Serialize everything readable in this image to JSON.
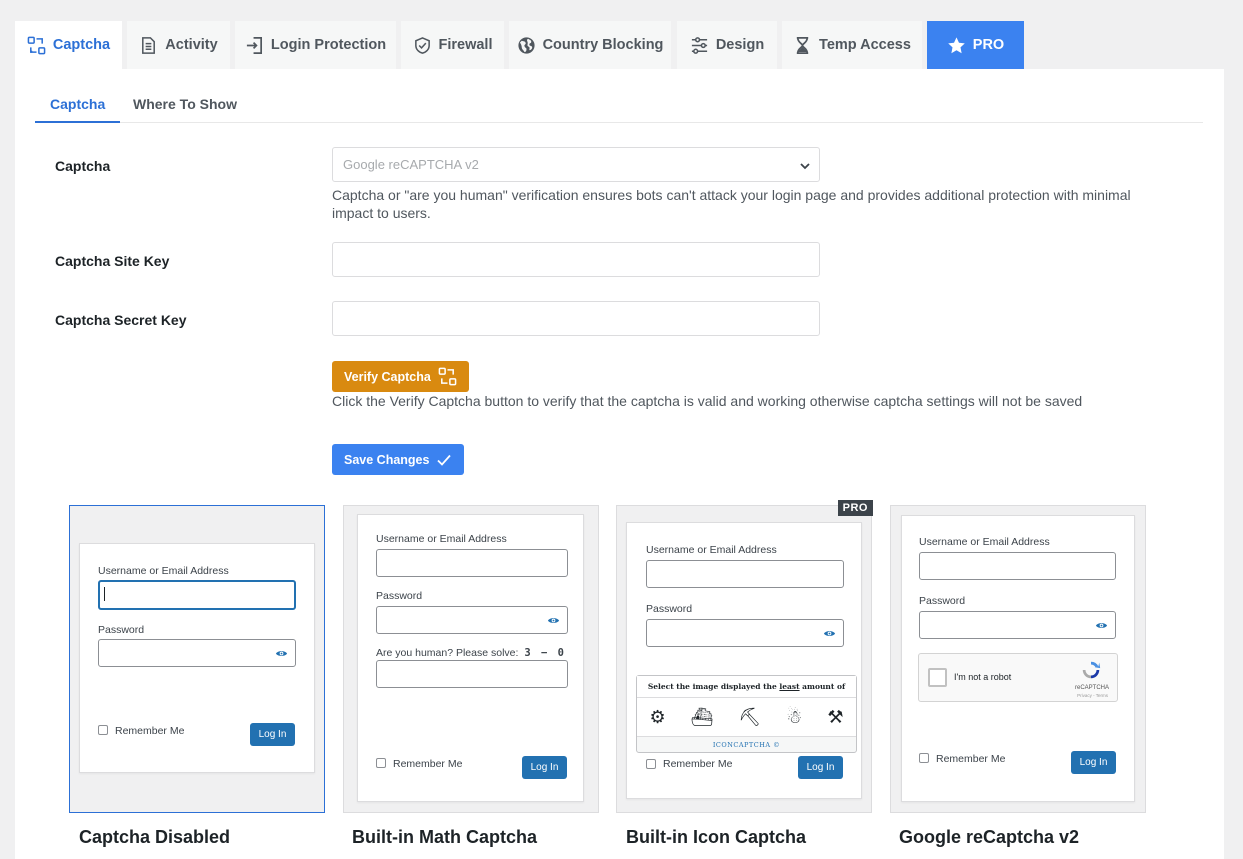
{
  "main_tabs": [
    {
      "label": "Captcha",
      "icon": "captcha-icon"
    },
    {
      "label": "Activity",
      "icon": "document-icon"
    },
    {
      "label": "Login Protection",
      "icon": "login-icon"
    },
    {
      "label": "Firewall",
      "icon": "shield-icon"
    },
    {
      "label": "Country Blocking",
      "icon": "globe-icon"
    },
    {
      "label": "Design",
      "icon": "sliders-icon"
    },
    {
      "label": "Temp Access",
      "icon": "hourglass-icon"
    },
    {
      "label": "PRO",
      "icon": "star-icon"
    }
  ],
  "sub_tabs": [
    {
      "label": "Captcha"
    },
    {
      "label": "Where To Show"
    }
  ],
  "form": {
    "captcha_label": "Captcha",
    "captcha_selected": "Google reCAPTCHA v2",
    "captcha_help": "Captcha or \"are you human\" verification ensures bots can't attack your login page and provides additional protection with minimal impact to users.",
    "site_key_label": "Captcha Site Key",
    "site_key_value": "",
    "secret_key_label": "Captcha Secret Key",
    "secret_key_value": "",
    "verify_button": "Verify Captcha",
    "verify_help": "Click the Verify Captcha button to verify that the captcha is valid and working otherwise captcha settings will not be saved",
    "save_button": "Save Changes"
  },
  "previews": {
    "username_label": "Username or Email Address",
    "password_label": "Password",
    "remember_label": "Remember Me",
    "login_button": "Log In",
    "pro_badge": "PRO",
    "math_prompt": "Are you human? Please solve:",
    "math_equation": "3 − 0",
    "icon_captcha_prefix": "Select the image displayed the ",
    "icon_captcha_emph": "least",
    "icon_captcha_suffix": " amount of times",
    "icon_captcha_brand": "ICONCAPTCHA ©",
    "recaptcha_text": "I'm not a robot",
    "recaptcha_brand": "reCAPTCHA",
    "recaptcha_terms": "Privacy - Terms",
    "cards": [
      {
        "title": "Captcha Disabled"
      },
      {
        "title": "Built-in Math Captcha"
      },
      {
        "title": "Built-in Icon Captcha"
      },
      {
        "title": "Google reCaptcha v2"
      }
    ]
  },
  "colors": {
    "accent": "#2c70d6",
    "pro_tab": "#3b82f0",
    "verify_button": "#d98a10",
    "save_button": "#3b82f0",
    "login_button": "#2271b1"
  }
}
